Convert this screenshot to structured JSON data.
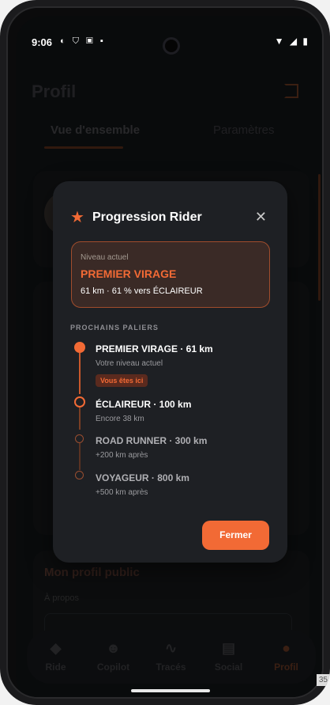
{
  "status": {
    "time": "9:06",
    "notification_icons": "◐ ⛉ ▣ ▪",
    "right_icons": "▼ ◢ ▮"
  },
  "background": {
    "page_title": "Profil",
    "tabs": [
      {
        "label": "Vue d'ensemble"
      },
      {
        "label": "Paramètres"
      }
    ],
    "public_profile_title": "Mon profil public",
    "about_label": "À propos"
  },
  "navbar": {
    "items": [
      {
        "label": "Ride",
        "icon": "ride-icon"
      },
      {
        "label": "Copilot",
        "icon": "copilot-icon"
      },
      {
        "label": "Tracés",
        "icon": "routes-icon"
      },
      {
        "label": "Social",
        "icon": "social-icon"
      },
      {
        "label": "Profil",
        "icon": "profile-icon"
      }
    ],
    "active": "Profil"
  },
  "modal": {
    "title": "Progression Rider",
    "current_level": {
      "label": "Niveau actuel",
      "name": "PREMIER VIRAGE",
      "progress_text": "61 km · 61 % vers ÉCLAIREUR"
    },
    "section_title": "PROCHAINS PALIERS",
    "milestones": [
      {
        "title": "PREMIER VIRAGE · 61 km",
        "subtitle": "Votre niveau actuel",
        "badge": "Vous êtes ici"
      },
      {
        "title": "ÉCLAIREUR · 100 km",
        "subtitle": "Encore 38 km"
      },
      {
        "title": "ROAD RUNNER · 300 km",
        "subtitle": "+200 km après"
      },
      {
        "title": "VOYAGEUR · 800 km",
        "subtitle": "+500 km après"
      }
    ],
    "close_button": "Fermer"
  },
  "edge_badge": "35",
  "colors": {
    "accent": "#f26a35",
    "modal_bg": "#1e2024",
    "screen_bg": "#121417"
  }
}
